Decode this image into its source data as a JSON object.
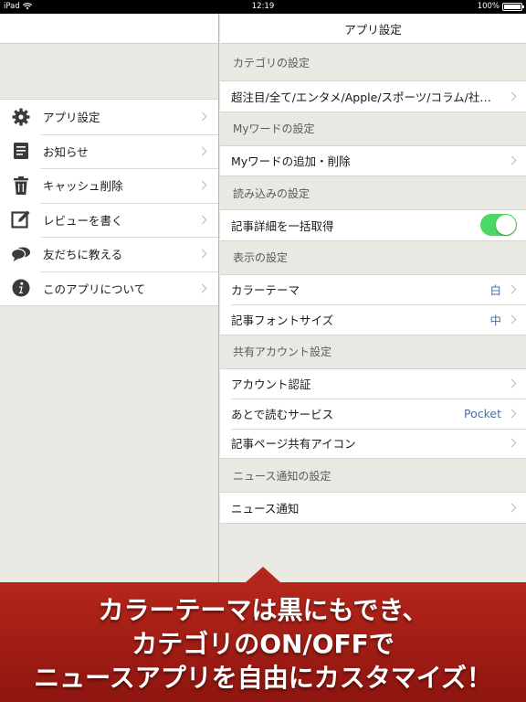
{
  "status_bar": {
    "device": "iPad",
    "time": "12:19",
    "battery": "100%"
  },
  "left_menu": {
    "items": [
      {
        "label": "アプリ設定",
        "icon": "gear-icon"
      },
      {
        "label": "お知らせ",
        "icon": "notice-icon"
      },
      {
        "label": "キャッシュ削除",
        "icon": "trash-icon"
      },
      {
        "label": "レビューを書く",
        "icon": "edit-icon"
      },
      {
        "label": "友だちに教える",
        "icon": "chat-bubble-icon"
      },
      {
        "label": "このアプリについて",
        "icon": "info-icon"
      }
    ]
  },
  "settings": {
    "title": "アプリ設定",
    "sections": [
      {
        "title": "カテゴリの設定",
        "rows": [
          {
            "label": "超注目/全て/エンタメ/Apple/スポーツ/コラム/社…"
          }
        ]
      },
      {
        "title": "Myワードの設定",
        "rows": [
          {
            "label": "Myワードの追加・削除"
          }
        ]
      },
      {
        "title": "読み込みの設定",
        "rows": [
          {
            "label": "記事詳細を一括取得",
            "toggle": true
          }
        ]
      },
      {
        "title": "表示の設定",
        "rows": [
          {
            "label": "カラーテーマ",
            "value": "白"
          },
          {
            "label": "記事フォントサイズ",
            "value": "中"
          }
        ]
      },
      {
        "title": "共有アカウント設定",
        "rows": [
          {
            "label": "アカウント認証"
          },
          {
            "label": "あとで読むサービス",
            "value": "Pocket"
          },
          {
            "label": "記事ページ共有アイコン"
          }
        ]
      },
      {
        "title": "ニュース通知の設定",
        "rows": [
          {
            "label": "ニュース通知"
          }
        ]
      }
    ]
  },
  "banner": {
    "line1": "カラーテーマは黒にもでき、",
    "line2": "カテゴリのON/OFFで",
    "line3": "ニュースアプリを自由にカスタマイズ！"
  },
  "colors": {
    "accent_toggle": "#4cd864",
    "value_text": "#4a6da0",
    "banner_red": "#b5261a"
  }
}
